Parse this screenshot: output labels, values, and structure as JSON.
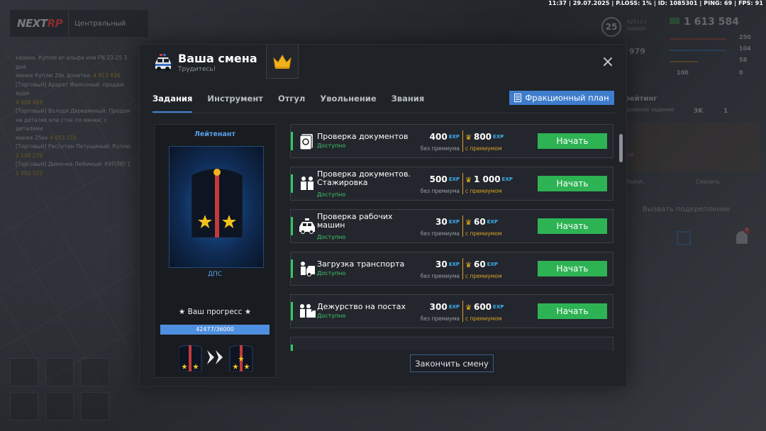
{
  "topbar": {
    "text": "11:37 | 29.07.2025 | P.LOSS: 1% | ID: 1085301 | PING: 69 | FPS: 91"
  },
  "branding": {
    "logo_main": "NEXT",
    "logo_accent": "RP",
    "server": "Центральный"
  },
  "chat": [
    {
      "text": "казино. Куплю иг-альфа или FN 23-25 3 дня",
      "money": ""
    },
    {
      "text": "минке Куплю 20к донатки.",
      "money": "4 913 836"
    },
    {
      "text": "[Торговый] Арарат Фимозный: продам ауди",
      "money": ""
    },
    {
      "text": "",
      "money": "4 008 469"
    },
    {
      "text": "[Торговый] Володя Деревянный: Продам",
      "money": ""
    },
    {
      "text": "на деталях или сток по минке, с деталями",
      "money": ""
    },
    {
      "text": "минке 25кк",
      "money": "4 053 710"
    },
    {
      "text": "[Торговый] Распутин Петушиный: Куплю",
      "money": ""
    },
    {
      "text": "",
      "money": "2 148 276"
    },
    {
      "text": "[Торговый] Димочка Любимый: КУПЛЮ 1",
      "money": ""
    },
    {
      "text": "",
      "money": "1 001 520"
    }
  ],
  "hud": {
    "level": "25",
    "xp_line1": "92511 /",
    "xp_line2": "500000",
    "money": "1 613 584",
    "stat979": "979",
    "health": "250",
    "armor": "104",
    "hunger": "58",
    "shield_val": "0",
    "extra_val": "100",
    "rating_label": "ц. рейтинг",
    "daily_label": "ежедневное задание",
    "rating_cash": "3K",
    "rating_one": "1",
    "chest_label": "ня",
    "radio_label": "ал: Выкл.",
    "radio_switch": "Сменить",
    "call_backup": "Вызвать подкрепление",
    "notif_count": "6"
  },
  "modal": {
    "title": "Ваша смена",
    "subtitle": "Трудитесь!",
    "close_symbol": "×",
    "tabs": [
      "Задания",
      "Инструмент",
      "Отгул",
      "Увольнение",
      "Звания"
    ],
    "plan_button": "Фракционный план",
    "finish_button": "Закончить смену"
  },
  "rank": {
    "name": "Лейтенант",
    "department": "ДПС",
    "progress_label": "★ Ваш прогресс ★",
    "progress_text": "42477/36000",
    "progress_fraction": 1.0
  },
  "tasks": [
    {
      "name": "Проверка документов",
      "status": "Доступно",
      "normal": "400",
      "premium": "800",
      "icon": "documents-icon",
      "two_line": false
    },
    {
      "name": "Проверка документов. Стажировка",
      "status": "Доступно",
      "normal": "500",
      "premium": "1 000",
      "icon": "officers-icon",
      "two_line": true
    },
    {
      "name": "Проверка рабочих машин",
      "status": "Доступно",
      "normal": "30",
      "premium": "60",
      "icon": "police-car-icon",
      "two_line": true
    },
    {
      "name": "Загрузка транспорта",
      "status": "Доступно",
      "normal": "30",
      "premium": "60",
      "icon": "tow-truck-icon",
      "two_line": false
    },
    {
      "name": "Дежурство на постах",
      "status": "Доступно",
      "normal": "300",
      "premium": "600",
      "icon": "duty-post-icon",
      "two_line": false
    }
  ],
  "task_labels": {
    "exp": "EXP",
    "without_premium": "без премиума",
    "with_premium": "с премиумом",
    "start": "Начать"
  },
  "colors": {
    "accent_blue": "#3e7ccc",
    "start_green": "#2eb354",
    "status_green": "#3ec86b",
    "premium_gold": "#d9a228",
    "exp_cyan": "#3ab0f0"
  }
}
